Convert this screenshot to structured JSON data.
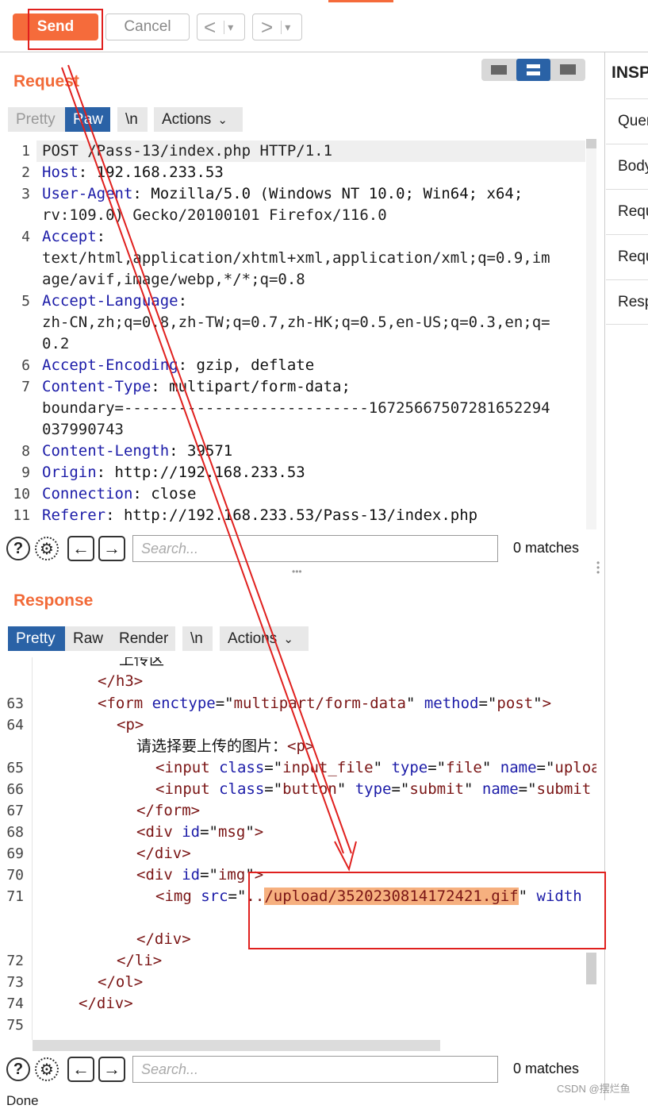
{
  "toolbar": {
    "send_label": "Send",
    "cancel_label": "Cancel",
    "back_glyph": "<",
    "forward_glyph": ">",
    "dropdown_glyph": "▾"
  },
  "request": {
    "title": "Request",
    "tabs": [
      "Pretty",
      "Raw",
      "\\n",
      "Actions"
    ],
    "active_tab": "Raw",
    "lines": [
      {
        "num": "1",
        "text": "POST /Pass-13/index.php HTTP/1.1"
      },
      {
        "num": "2",
        "key": "Host",
        "value": ": 192.168.233.53"
      },
      {
        "num": "3",
        "key": "User-Agent",
        "value": ": Mozilla/5.0 (Windows NT 10.0; Win64; x64;"
      },
      {
        "num": "",
        "text": "rv:109.0) Gecko/20100101 Firefox/116.0"
      },
      {
        "num": "4",
        "key": "Accept",
        "value": ":"
      },
      {
        "num": "",
        "text": "text/html,application/xhtml+xml,application/xml;q=0.9,im"
      },
      {
        "num": "",
        "text": "age/avif,image/webp,*/*;q=0.8"
      },
      {
        "num": "5",
        "key": "Accept-Language",
        "value": ":"
      },
      {
        "num": "",
        "text": "zh-CN,zh;q=0.8,zh-TW;q=0.7,zh-HK;q=0.5,en-US;q=0.3,en;q="
      },
      {
        "num": "",
        "text": "0.2"
      },
      {
        "num": "6",
        "key": "Accept-Encoding",
        "value": ": gzip, deflate"
      },
      {
        "num": "7",
        "key": "Content-Type",
        "value": ": multipart/form-data;"
      },
      {
        "num": "",
        "text": "boundary=---------------------------16725667507281652294"
      },
      {
        "num": "",
        "text": "037990743"
      },
      {
        "num": "8",
        "key": "Content-Length",
        "value": ": 39571"
      },
      {
        "num": "9",
        "key": "Origin",
        "value": ": http://192.168.233.53"
      },
      {
        "num": "10",
        "key": "Connection",
        "value": ": close"
      },
      {
        "num": "11",
        "key": "Referer",
        "value": ": http://192.168.233.53/Pass-13/index.php"
      }
    ],
    "search_placeholder": "Search...",
    "matches": "0 matches"
  },
  "response": {
    "title": "Response",
    "tabs": [
      "Pretty",
      "Raw",
      "Render",
      "\\n",
      "Actions"
    ],
    "active_tab": "Pretty",
    "partial_top": "上传区",
    "search_placeholder": "Search...",
    "matches": "0 matches",
    "highlight_path": "/upload/3520230814172421.gif"
  },
  "inspector": {
    "title": "INSP",
    "items": [
      "Quer",
      "Body",
      "Requ",
      "Requ",
      "Resp"
    ]
  },
  "footer": {
    "status": "Done",
    "watermark": "CSDN @摆烂鱼"
  },
  "colors": {
    "accent": "#f56b3b",
    "active_tab": "#2a62a6",
    "annotation_red": "#e0201e",
    "highlight": "#f6b07f"
  }
}
